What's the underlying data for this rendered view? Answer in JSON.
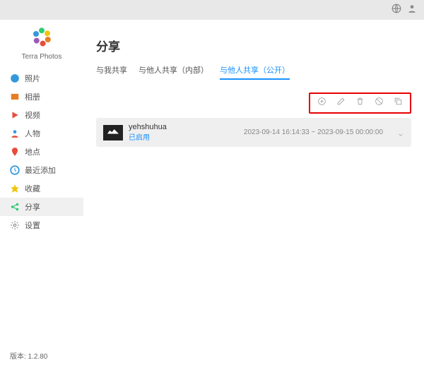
{
  "brand": "Terra Photos",
  "page_title": "分享",
  "tabs": [
    "与我共享",
    "与他人共享（内部）",
    "与他人共享（公开）"
  ],
  "active_tab_index": 2,
  "sidebar": {
    "items": [
      {
        "label": "照片"
      },
      {
        "label": "相册"
      },
      {
        "label": "视频"
      },
      {
        "label": "人物"
      },
      {
        "label": "地点"
      },
      {
        "label": "最近添加"
      },
      {
        "label": "收藏"
      },
      {
        "label": "分享"
      },
      {
        "label": "设置"
      }
    ],
    "active_index": 7
  },
  "share_item": {
    "name": "yehshuhua",
    "status": "已启用",
    "date": "2023-09-14 16:14:33 ~ 2023-09-15 00:00:00"
  },
  "version": "版本: 1.2.80"
}
